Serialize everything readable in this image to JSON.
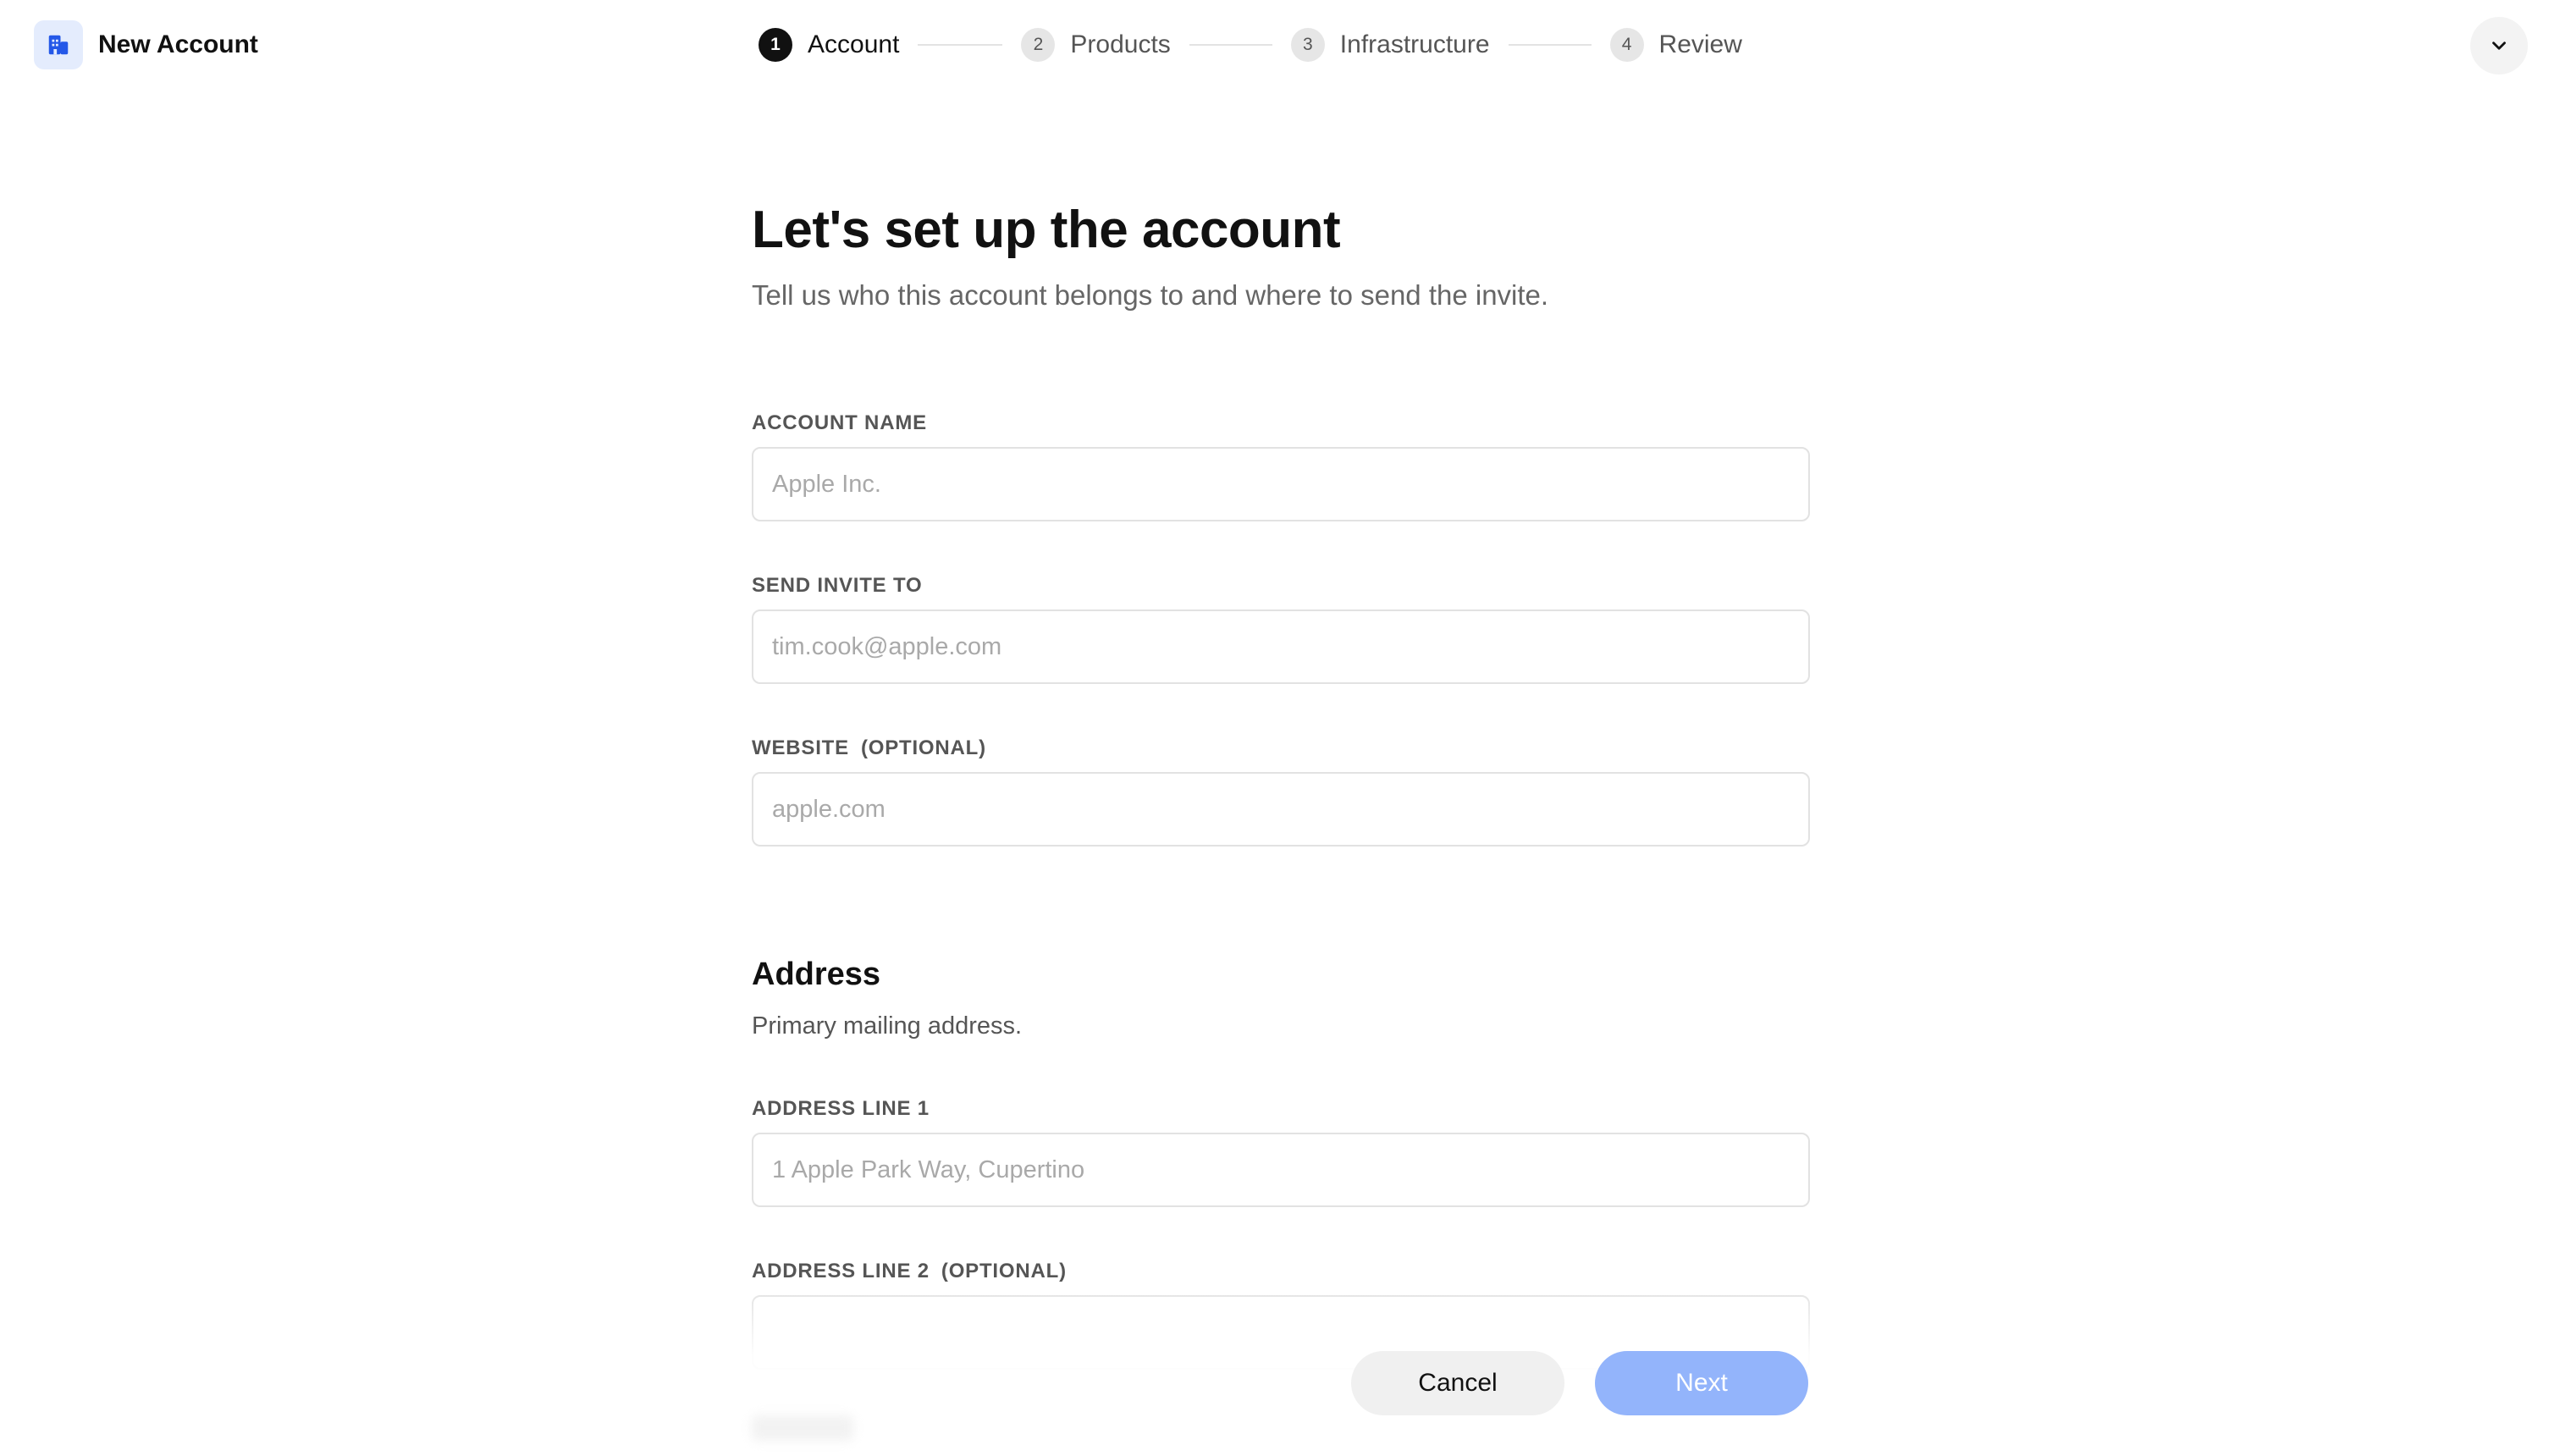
{
  "header": {
    "title": "New Account",
    "brand_icon": "building-icon",
    "collapse_icon": "chevron-down-icon"
  },
  "steps": [
    {
      "num": "1",
      "label": "Account",
      "active": true
    },
    {
      "num": "2",
      "label": "Products",
      "active": false
    },
    {
      "num": "3",
      "label": "Infrastructure",
      "active": false
    },
    {
      "num": "4",
      "label": "Review",
      "active": false
    }
  ],
  "main": {
    "title": "Let's set up the account",
    "subtitle": "Tell us who this account belongs to and where to send the invite."
  },
  "fields": {
    "account_name": {
      "label": "ACCOUNT NAME",
      "placeholder": "Apple Inc.",
      "value": ""
    },
    "send_invite": {
      "label": "SEND INVITE TO",
      "placeholder": "tim.cook@apple.com",
      "value": ""
    },
    "website": {
      "label": "WEBSITE",
      "optional": "(OPTIONAL)",
      "placeholder": "apple.com",
      "value": ""
    }
  },
  "address": {
    "title": "Address",
    "subtitle": "Primary mailing address.",
    "line1": {
      "label": "ADDRESS LINE 1",
      "placeholder": "1 Apple Park Way, Cupertino",
      "value": ""
    },
    "line2": {
      "label": "ADDRESS LINE 2",
      "optional": "(OPTIONAL)",
      "placeholder": "",
      "value": ""
    }
  },
  "actions": {
    "cancel_label": "Cancel",
    "next_label": "Next"
  },
  "colors": {
    "accent": "#2458e8",
    "next_button": "#93b4fb",
    "brand_icon_bg": "#e4ecfd"
  }
}
